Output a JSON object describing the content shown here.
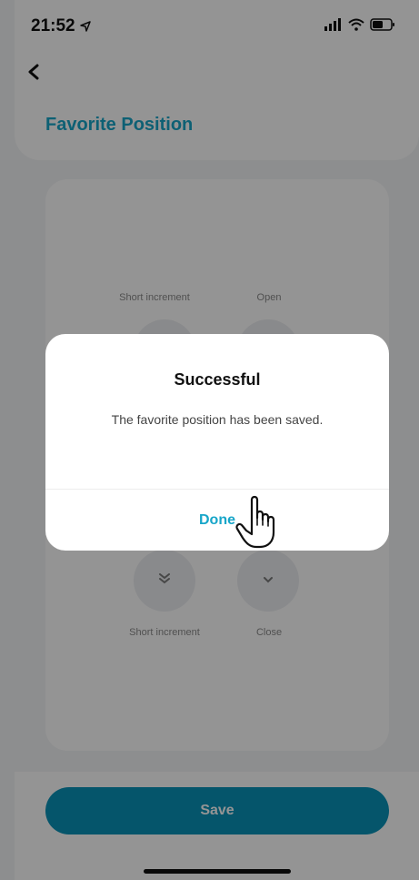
{
  "status_bar": {
    "time": "21:52"
  },
  "header": {
    "title": "Favorite Position",
    "back_icon": "chevron-left-icon"
  },
  "controls": {
    "top_left_label": "Short increment",
    "top_right_label": "Open",
    "bottom_left_label": "Short increment",
    "bottom_right_label": "Close"
  },
  "dialog": {
    "title": "Successful",
    "message": "The favorite position has been saved.",
    "button_label": "Done"
  },
  "footer": {
    "save_label": "Save"
  },
  "colors": {
    "accent": "#18a6c9",
    "save_button": "#0a93b8"
  }
}
